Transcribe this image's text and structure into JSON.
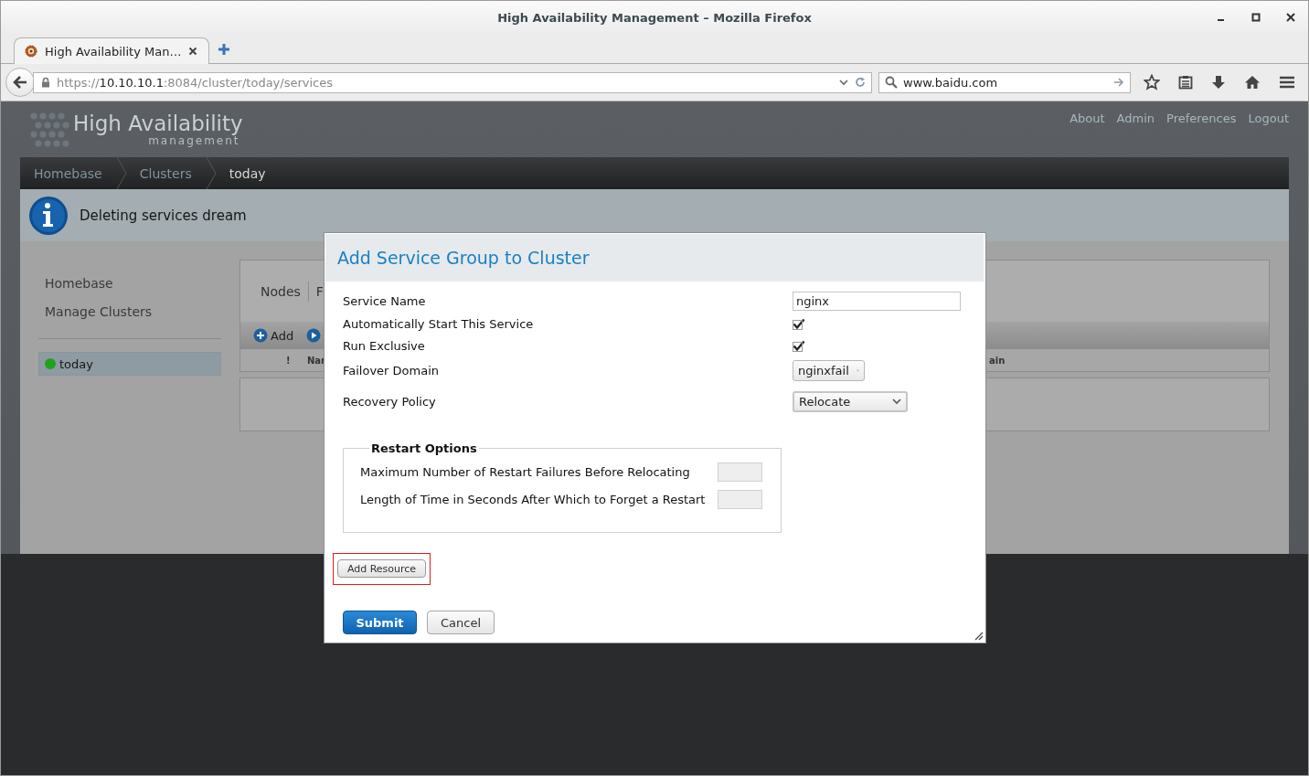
{
  "window": {
    "title": "High Availability Management – Mozilla Firefox"
  },
  "tabs": [
    {
      "label": "High Availability Man…",
      "selected": true
    }
  ],
  "address_bar": {
    "scheme": "https://",
    "host": "10.10.10.1",
    "path": ":8084/cluster/today/services"
  },
  "search_field": {
    "value": "www.baidu.com"
  },
  "app": {
    "logo_title": "High Availability",
    "logo_subtitle": "management",
    "top_links": [
      "About",
      "Admin",
      "Preferences",
      "Logout"
    ]
  },
  "breadcrumbs": [
    {
      "label": "Homebase",
      "selected": false
    },
    {
      "label": "Clusters",
      "selected": false
    },
    {
      "label": "today",
      "selected": true
    }
  ],
  "message": {
    "kind": "info",
    "text": "Deleting services dream"
  },
  "sidebar": {
    "items": [
      "Homebase",
      "Manage Clusters"
    ],
    "clusters": [
      {
        "label": "today",
        "selected": true,
        "color": "#21a121"
      }
    ]
  },
  "panel": {
    "tabs": [
      "Nodes",
      "F"
    ],
    "toolbar": [
      {
        "kind": "add",
        "label": "Add"
      },
      {
        "kind": "play"
      }
    ],
    "columns": [
      "!",
      "Nar",
      "ain"
    ]
  },
  "dialog": {
    "title": "Add Service Group to Cluster",
    "fields": [
      {
        "kind": "text",
        "label": "Service Name",
        "value": "nginx"
      },
      {
        "kind": "checkbox",
        "label": "Automatically Start This Service",
        "checked": true
      },
      {
        "kind": "checkbox",
        "label": "Run Exclusive",
        "checked": true
      },
      {
        "kind": "select",
        "label": "Failover Domain",
        "value": "nginxfail"
      },
      {
        "kind": "select",
        "label": "Recovery Policy",
        "value": "Relocate"
      }
    ],
    "restart_options": {
      "legend": "Restart Options",
      "fields": [
        {
          "label": "Maximum Number of Restart Failures Before Relocating",
          "disabled": true
        },
        {
          "label": "Length of Time in Seconds After Which to Forget a Restart",
          "disabled": true
        }
      ]
    },
    "resource_button": {
      "label": "Add Resource",
      "highlighted": true
    },
    "buttons": [
      {
        "kind": "primary",
        "label": "Submit"
      },
      {
        "kind": "secondary",
        "label": "Cancel"
      }
    ]
  }
}
